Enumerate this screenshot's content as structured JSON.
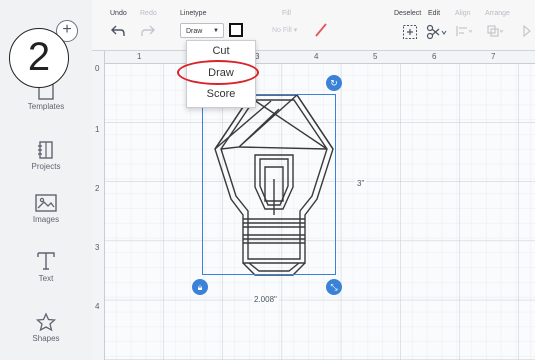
{
  "step": {
    "number": "2"
  },
  "sidebar": {
    "new_label": "+",
    "items": [
      {
        "label": "Templates",
        "icon": "templates-icon"
      },
      {
        "label": "Projects",
        "icon": "projects-icon"
      },
      {
        "label": "Images",
        "icon": "images-icon"
      },
      {
        "label": "Text",
        "icon": "text-icon"
      },
      {
        "label": "Shapes",
        "icon": "shapes-icon"
      }
    ]
  },
  "toolbar": {
    "undo_label": "Undo",
    "redo_label": "Redo",
    "linetype_label": "Linetype",
    "linetype_value": "Draw",
    "fill_label": "Fill",
    "fill_value": "No Fill",
    "deselect_label": "Deselect",
    "edit_label": "Edit",
    "align_label": "Align",
    "arrange_label": "Arrange"
  },
  "linetype_menu": {
    "options": [
      "Cut",
      "Draw",
      "Score"
    ],
    "highlighted": "Draw"
  },
  "rulers": {
    "top": [
      "0",
      "1",
      "2",
      "3",
      "4",
      "5",
      "6",
      "7"
    ],
    "left": [
      "0",
      "1",
      "2",
      "3",
      "4"
    ]
  },
  "selection": {
    "height_label": "3\"",
    "width_label": "2.008\""
  },
  "colors": {
    "accent": "#3a82d8",
    "highlight": "#d8232a",
    "pen": "#e2555c"
  }
}
